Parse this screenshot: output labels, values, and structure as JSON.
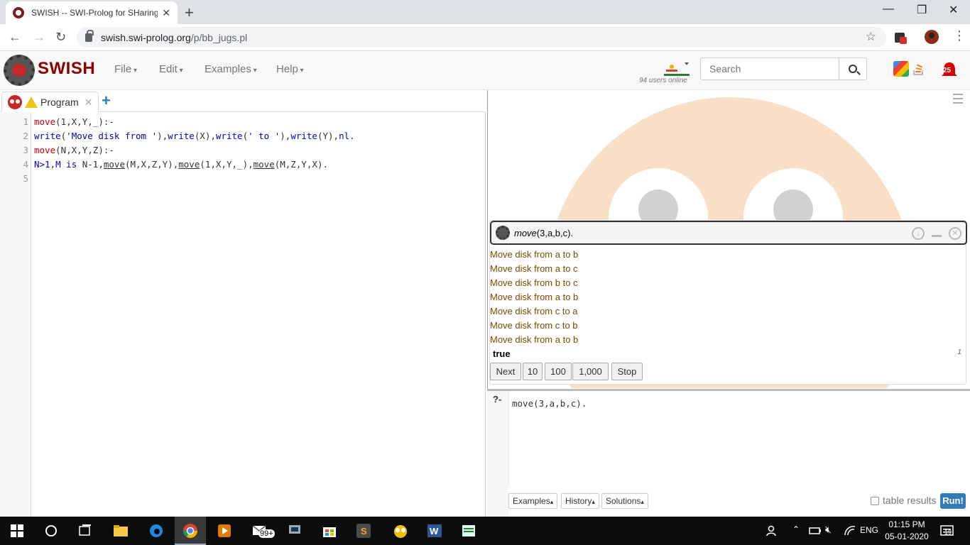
{
  "browser": {
    "tab_title": "SWISH -- SWI-Prolog for SHaring",
    "url_host": "swish.swi-prolog.org",
    "url_path": "/p/bb_jugs.pl"
  },
  "navbar": {
    "brand": "SWISH",
    "menus": [
      "File",
      "Edit",
      "Examples",
      "Help"
    ],
    "users_online": "94 users online",
    "search_placeholder": "Search",
    "notification_count": "25"
  },
  "program_tab": {
    "label": "Program"
  },
  "editor": {
    "line_numbers": [
      "1",
      "2",
      "3",
      "4",
      "5"
    ]
  },
  "answer": {
    "query_head": "move",
    "query_args": "(3,a,b,c).",
    "output_lines": [
      "Move disk from a to b",
      "Move disk from a to c",
      "Move disk from b to c",
      "Move disk from a to b",
      "Move disk from c to a",
      "Move disk from c to b",
      "Move disk from a to b"
    ],
    "result": "true",
    "solution_count": "1",
    "buttons": [
      "Next",
      "10",
      "100",
      "1,000",
      "Stop"
    ]
  },
  "query_editor": {
    "prompt": "?-",
    "query": "move(3,a,b,c).",
    "buttons": [
      "Examples",
      "History",
      "Solutions"
    ],
    "table_results_label": "table results",
    "run_label": "Run!"
  },
  "taskbar": {
    "mail_badge": "99+",
    "language": "ENG",
    "time": "01:15 PM",
    "date": "05-01-2020",
    "notifications": "19"
  }
}
